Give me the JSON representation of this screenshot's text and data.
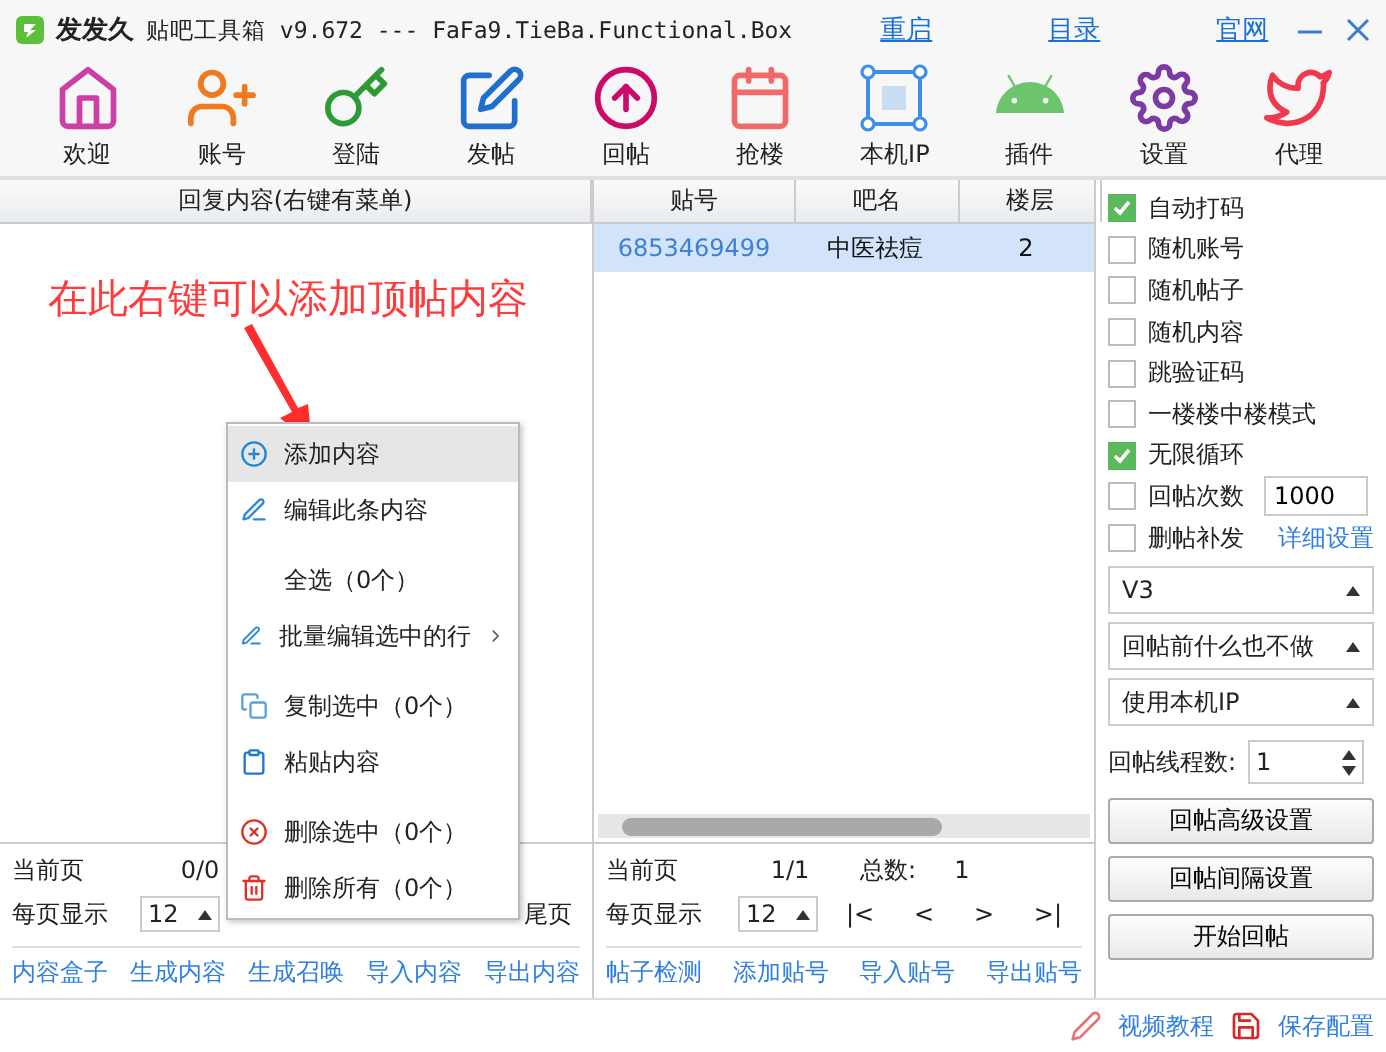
{
  "title_bar": {
    "app_name": "发发久",
    "title": "贴吧工具箱 v9.672 --- FaFa9.TieBa.Functional.Box",
    "links": [
      "重启",
      "目录",
      "官网"
    ]
  },
  "toolbar": [
    {
      "label": "欢迎",
      "kind": "home"
    },
    {
      "label": "账号",
      "kind": "account"
    },
    {
      "label": "登陆",
      "kind": "key"
    },
    {
      "label": "发帖",
      "kind": "post"
    },
    {
      "label": "回帖",
      "kind": "reply"
    },
    {
      "label": "抢楼",
      "kind": "building"
    },
    {
      "label": "本机IP",
      "kind": "ip"
    },
    {
      "label": "插件",
      "kind": "android"
    },
    {
      "label": "设置",
      "kind": "settings"
    },
    {
      "label": "代理",
      "kind": "bird"
    }
  ],
  "content_panel": {
    "header": "回复内容(右键有菜单)",
    "annotation": "在此右键可以添加顶帖内容",
    "pager": {
      "current_label": "当前页",
      "current": "0/0",
      "per_page_label": "每页显示",
      "per_page": "12",
      "nav": [
        "尾页"
      ]
    },
    "links": [
      "内容盒子",
      "生成内容",
      "生成召唤",
      "导入内容",
      "导出内容"
    ]
  },
  "context_menu": [
    {
      "label": "添加内容",
      "kind": "add",
      "selected": true,
      "separator_before": false,
      "submenu": false
    },
    {
      "label": "编辑此条内容",
      "kind": "edit",
      "selected": false,
      "separator_before": false,
      "submenu": false
    },
    {
      "label": "全选（0个）",
      "kind": "none",
      "selected": false,
      "separator_before": true,
      "submenu": false
    },
    {
      "label": "批量编辑选中的行",
      "kind": "edit",
      "selected": false,
      "separator_before": false,
      "submenu": true
    },
    {
      "label": "复制选中（0个）",
      "kind": "copy",
      "selected": false,
      "separator_before": true,
      "submenu": false
    },
    {
      "label": "粘贴内容",
      "kind": "paste",
      "selected": false,
      "separator_before": false,
      "submenu": false
    },
    {
      "label": "删除选中（0个）",
      "kind": "delete",
      "selected": false,
      "separator_before": true,
      "submenu": false
    },
    {
      "label": "删除所有（0个）",
      "kind": "trash",
      "selected": false,
      "separator_before": false,
      "submenu": false
    }
  ],
  "posts_table": {
    "columns": [
      "贴号",
      "吧名",
      "楼层"
    ],
    "rows": [
      {
        "cells": [
          "6853469499",
          "中医祛痘",
          "2"
        ],
        "selected": true
      }
    ],
    "pager": {
      "current_label": "当前页",
      "current": "1/1",
      "total_label": "总数:",
      "total": "1",
      "per_page_label": "每页显示",
      "per_page": "12",
      "nav": [
        "|<",
        "<",
        ">",
        ">|"
      ]
    },
    "links": [
      "帖子检测",
      "添加贴号",
      "导入贴号",
      "导出贴号"
    ]
  },
  "options": {
    "checkboxes": [
      {
        "label": "自动打码",
        "checked": true
      },
      {
        "label": "随机账号",
        "checked": false
      },
      {
        "label": "随机帖子",
        "checked": false
      },
      {
        "label": "随机内容",
        "checked": false
      },
      {
        "label": "跳验证码",
        "checked": false
      },
      {
        "label": "一楼楼中楼模式",
        "checked": false
      },
      {
        "label": "无限循环",
        "checked": true
      },
      {
        "label": "回帖次数",
        "checked": false,
        "value": "1000"
      },
      {
        "label": "删帖补发",
        "checked": false,
        "link": "详细设置"
      }
    ],
    "dropdowns": [
      "V3",
      "回帖前什么也不做",
      "使用本机IP"
    ],
    "thread_count": {
      "label": "回帖线程数:",
      "value": "1"
    },
    "buttons": [
      "回帖高级设置",
      "回帖间隔设置",
      "开始回帖"
    ]
  },
  "footer": [
    {
      "label": "视频教程",
      "kind": "pencil"
    },
    {
      "label": "保存配置",
      "kind": "save"
    }
  ]
}
